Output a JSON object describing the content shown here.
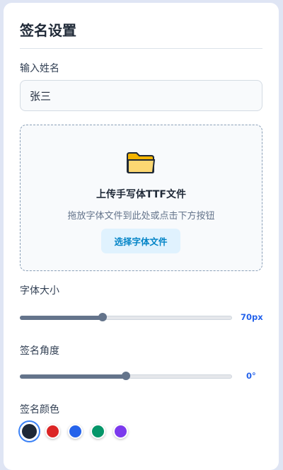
{
  "panel": {
    "title": "签名设置",
    "name_label": "输入姓名",
    "name_value": "张三",
    "upload": {
      "icon": "folder-icon",
      "title": "上传手写体TTF文件",
      "hint": "拖放字体文件到此处或点击下方按钮",
      "button_label": "选择字体文件"
    },
    "font_size": {
      "label": "字体大小",
      "value": 70,
      "value_text": "70px",
      "fraction": 0.39
    },
    "angle": {
      "label": "签名角度",
      "value": 0,
      "value_text": "0°",
      "fraction": 0.5
    },
    "color": {
      "label": "签名颜色",
      "options": [
        "#1f2937",
        "#dc2626",
        "#2563eb",
        "#059669",
        "#7c3aed"
      ],
      "selected_index": 0
    }
  }
}
